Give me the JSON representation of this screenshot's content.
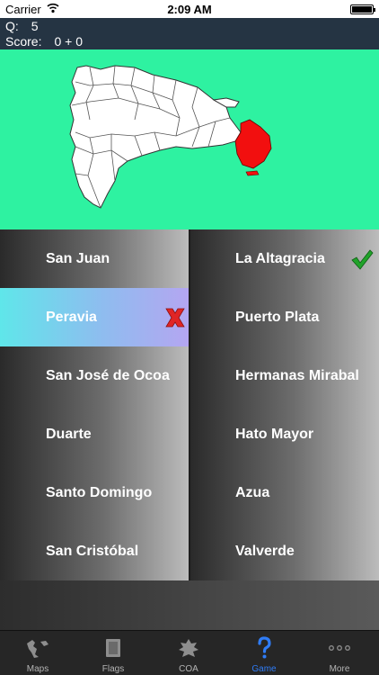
{
  "status_bar": {
    "carrier": "Carrier",
    "time": "2:09 AM"
  },
  "score": {
    "q_label": "Q:",
    "q_value": "5",
    "score_label": "Score:",
    "score_value": "0 + 0"
  },
  "map": {
    "highlight_color": "#f20f0f",
    "background_color": "#2ef2a1"
  },
  "answers": {
    "left": [
      {
        "label": "San Juan",
        "state": "normal"
      },
      {
        "label": "Peravia",
        "state": "wrong"
      },
      {
        "label": "San José de Ocoa",
        "state": "normal"
      },
      {
        "label": "Duarte",
        "state": "normal"
      },
      {
        "label": "Santo Domingo",
        "state": "normal"
      },
      {
        "label": "San Cristóbal",
        "state": "normal"
      }
    ],
    "right": [
      {
        "label": "La Altagracia",
        "state": "correct"
      },
      {
        "label": "Puerto Plata",
        "state": "normal"
      },
      {
        "label": "Hermanas Mirabal",
        "state": "normal"
      },
      {
        "label": "Hato Mayor",
        "state": "normal"
      },
      {
        "label": "Azua",
        "state": "normal"
      },
      {
        "label": "Valverde",
        "state": "normal"
      }
    ]
  },
  "tabs": [
    {
      "label": "Maps",
      "icon": "map-icon",
      "active": false
    },
    {
      "label": "Flags",
      "icon": "flag-icon",
      "active": false
    },
    {
      "label": "COA",
      "icon": "coat-of-arms-icon",
      "active": false
    },
    {
      "label": "Game",
      "icon": "question-icon",
      "active": true
    },
    {
      "label": "More",
      "icon": "more-icon",
      "active": false
    }
  ],
  "colors": {
    "active_tab": "#2f7cf6",
    "correct": "#21a32a",
    "wrong": "#e02525"
  }
}
